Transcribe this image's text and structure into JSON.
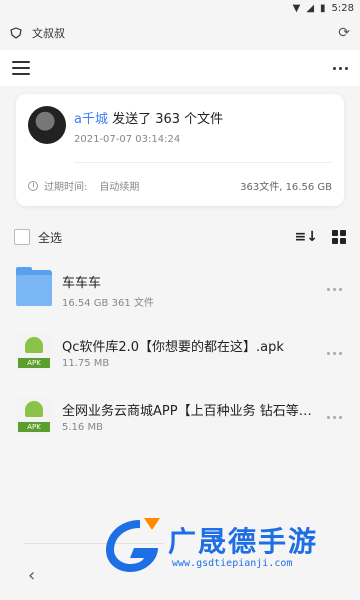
{
  "status_bar": {
    "time": "5:28"
  },
  "header": {
    "title": "文叔叔"
  },
  "share": {
    "user": "a千城",
    "message": " 发送了 363 个文件",
    "time": "2021-07-07 03:14:24",
    "expire_label": "过期时间:",
    "expire_value": "自动续期",
    "summary": "363文件, 16.56 GB"
  },
  "select_all_label": "全选",
  "files": [
    {
      "name": "车车车",
      "meta": "16.54 GB 361 文件",
      "type": "folder"
    },
    {
      "name": "Qc软件库2.0【你想要的都在这】.apk",
      "meta": "11.75 MB",
      "type": "apk"
    },
    {
      "name": "全网业务云商城APP【上百种业务 钻石等】.apk",
      "meta": "5.16 MB",
      "type": "apk"
    }
  ],
  "apk_tag": "APK",
  "watermark": {
    "brand": "广晟德手游",
    "url": "www.gsdtiepianji.com"
  }
}
